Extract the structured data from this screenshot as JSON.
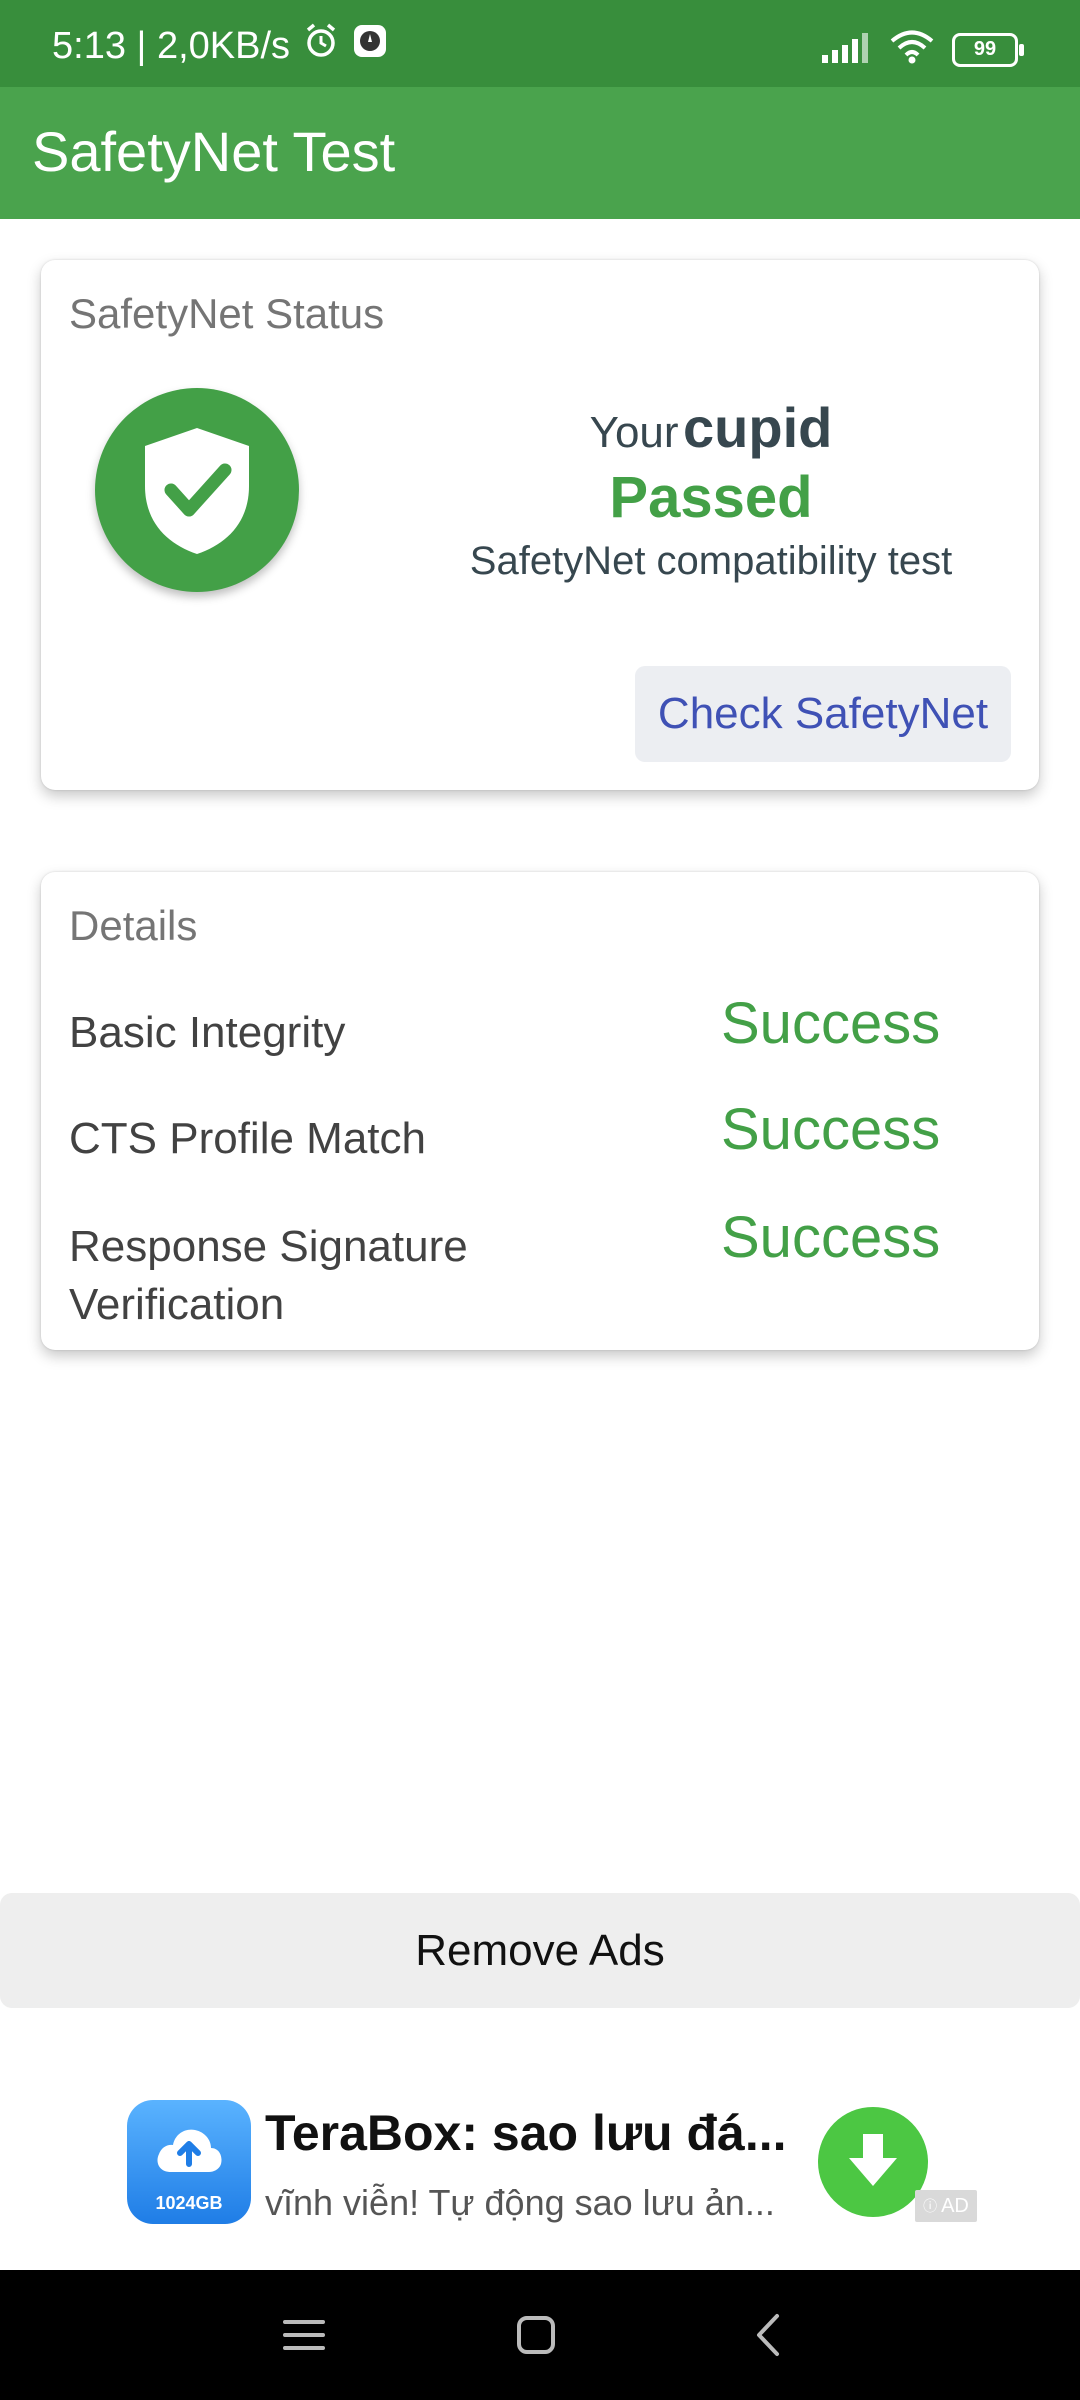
{
  "status_bar": {
    "time": "5:13 | 2,0KB/s",
    "battery": "99"
  },
  "app_bar": {
    "title": "SafetyNet Test"
  },
  "status_card": {
    "title": "SafetyNet Status",
    "prefix": "Your",
    "device": "cupid",
    "result": "Passed",
    "subtitle": "SafetyNet compatibility test",
    "button_label": "Check SafetyNet",
    "shield_icon": "shield-check-icon",
    "colors": {
      "success": "#43a047",
      "button_text": "#3f51b5"
    }
  },
  "details_card": {
    "title": "Details",
    "rows": [
      {
        "label": "Basic Integrity",
        "value": "Success"
      },
      {
        "label": "CTS Profile Match",
        "value": "Success"
      },
      {
        "label": "Response Signature Verification",
        "value": "Success"
      }
    ]
  },
  "remove_ads": {
    "label": "Remove Ads"
  },
  "ad": {
    "icon_label": "1024GB",
    "title": "TeraBox: sao lưu đá...",
    "subtitle": "vĩnh viễn! Tự động sao lưu ản...",
    "badge": "AD"
  },
  "nav_bar": {
    "icons": [
      "menu-icon",
      "home-square-icon",
      "back-icon"
    ]
  }
}
